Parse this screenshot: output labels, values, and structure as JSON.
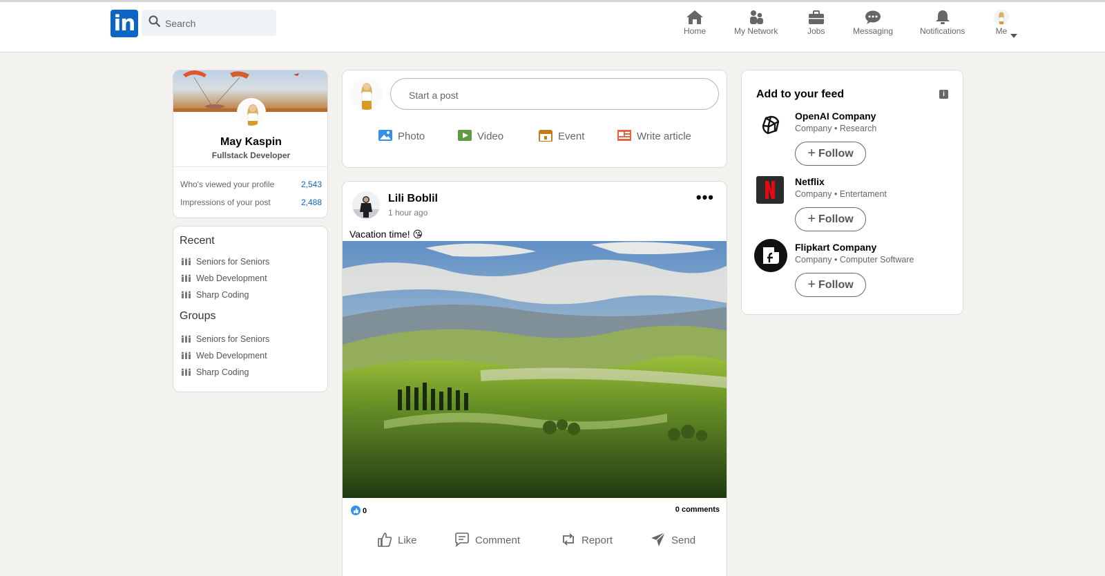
{
  "header": {
    "search_placeholder": "Search",
    "nav": [
      {
        "label": "Home",
        "icon": "home-icon"
      },
      {
        "label": "My Network",
        "icon": "network-icon"
      },
      {
        "label": "Jobs",
        "icon": "briefcase-icon"
      },
      {
        "label": "Messaging",
        "icon": "chat-icon"
      },
      {
        "label": "Notifications",
        "icon": "bell-icon"
      },
      {
        "label": "Me",
        "icon": "avatar"
      }
    ]
  },
  "profile": {
    "name": "May Kaspin",
    "title": "Fullstack Developer",
    "stats": [
      {
        "label": "Who's viewed your profile",
        "value": "2,543"
      },
      {
        "label": "Impressions of your post",
        "value": "2,488"
      }
    ]
  },
  "sidebar": {
    "recent_title": "Recent",
    "recent": [
      "Seniors for Seniors",
      "Web Development",
      "Sharp Coding"
    ],
    "groups_title": "Groups",
    "groups": [
      "Seniors for Seniors",
      "Web Development",
      "Sharp Coding"
    ]
  },
  "composer": {
    "placeholder": "Start a post",
    "actions": [
      {
        "label": "Photo",
        "color": "#378fe9"
      },
      {
        "label": "Video",
        "color": "#5f9b41"
      },
      {
        "label": "Event",
        "color": "#c37d16"
      },
      {
        "label": "Write article",
        "color": "#e06847"
      }
    ]
  },
  "post": {
    "author": "Lili Boblil",
    "time": "1 hour ago",
    "text": "Vacation time! 😘",
    "reactions": "0",
    "comments": "0 comments",
    "actions": [
      "Like",
      "Comment",
      "Report",
      "Send"
    ]
  },
  "feed": {
    "title": "Add to your feed",
    "follow_label": "Follow",
    "items": [
      {
        "name": "OpenAI Company",
        "sub": "Company • Research"
      },
      {
        "name": "Netflix",
        "sub": "Company • Entertament"
      },
      {
        "name": "Flipkart Company",
        "sub": "Company • Computer Software"
      }
    ]
  },
  "colors": {
    "brand": "#0a66c2",
    "background": "#f3f2ef"
  }
}
